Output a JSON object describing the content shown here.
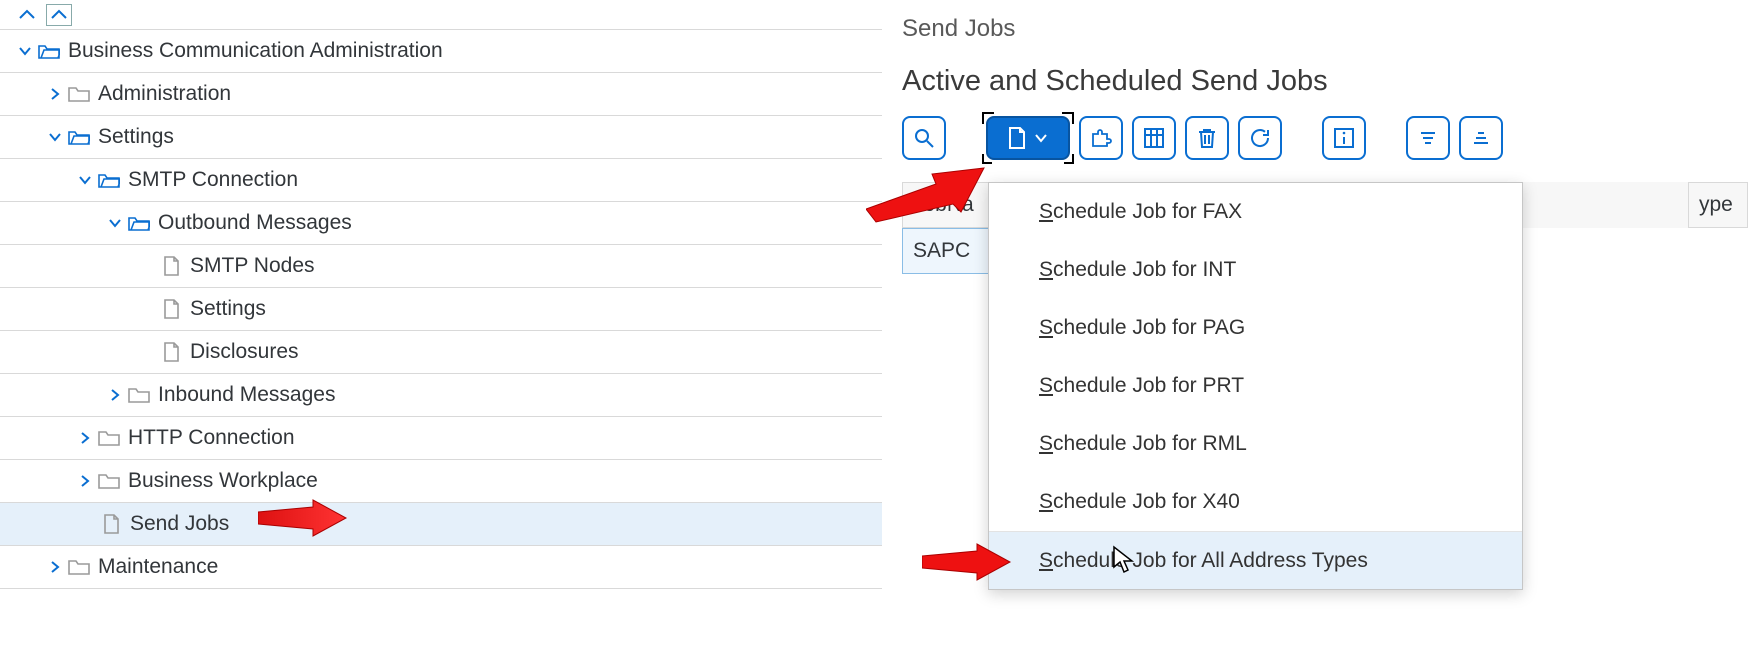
{
  "tree": {
    "root": "Business Communication Administration",
    "items": {
      "admin": "Administration",
      "settings": "Settings",
      "smtp": "SMTP Connection",
      "outbound": "Outbound Messages",
      "smtp_nodes": "SMTP Nodes",
      "smtp_settings": "Settings",
      "disclosures": "Disclosures",
      "inbound": "Inbound Messages",
      "http": "HTTP Connection",
      "workplace": "Business Workplace",
      "send_jobs": "Send Jobs",
      "maintenance": "Maintenance"
    }
  },
  "right": {
    "page_header": "Send Jobs",
    "section_title": "Active and Scheduled Send Jobs",
    "columns": {
      "jobname": "JobNa",
      "type": "ype"
    },
    "rows": [
      {
        "jobname": "SAPC"
      }
    ]
  },
  "menu": {
    "items": [
      "Schedule Job for FAX",
      "Schedule Job for INT",
      "Schedule Job for PAG",
      "Schedule Job for PRT",
      "Schedule Job for RML",
      "Schedule Job for X40",
      "Schedule Job for All Address Types"
    ]
  }
}
